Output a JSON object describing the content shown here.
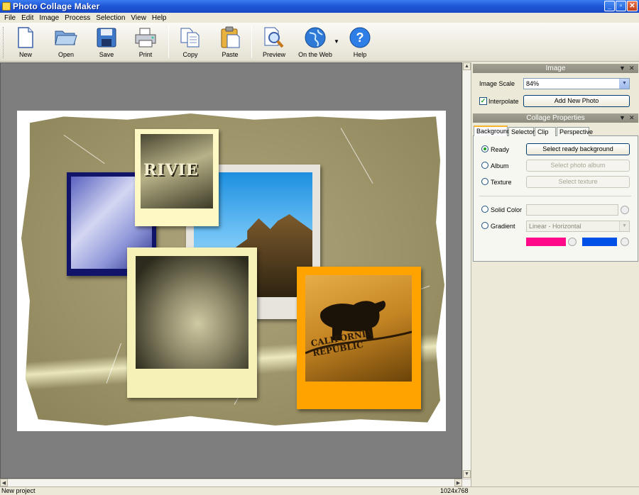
{
  "window": {
    "title": "Photo Collage Maker"
  },
  "menu": [
    "File",
    "Edit",
    "Image",
    "Process",
    "Selection",
    "View",
    "Help"
  ],
  "toolbar": {
    "buttons": [
      {
        "label": "New",
        "icon": "new-document-icon"
      },
      {
        "label": "Open",
        "icon": "open-folder-icon"
      },
      {
        "label": "Save",
        "icon": "floppy-disk-icon"
      },
      {
        "label": "Print",
        "icon": "printer-icon"
      },
      {
        "label": "Copy",
        "icon": "copy-icon"
      },
      {
        "label": "Paste",
        "icon": "clipboard-icon"
      },
      {
        "label": "Preview",
        "icon": "magnifier-icon"
      },
      {
        "label": "On the Web",
        "icon": "globe-icon"
      },
      {
        "label": "Help",
        "icon": "help-icon"
      }
    ]
  },
  "canvas": {
    "photos": [
      {
        "name": "blue-flag-photo"
      },
      {
        "name": "building-photo"
      },
      {
        "name": "rivie-sign-photo",
        "text": "RIVIE"
      },
      {
        "name": "bunny-photo"
      },
      {
        "name": "california-flag-photo",
        "text": "CALIFORNIA REPUBLIC"
      }
    ]
  },
  "image_panel": {
    "title": "Image",
    "scale_label": "Image Scale",
    "scale_value": "84%",
    "interpolate_label": "Interpolate",
    "interpolate_checked": true,
    "add_photo_label": "Add New Photo"
  },
  "collage_panel": {
    "title": "Collage Properties",
    "tabs": [
      "Background",
      "Selector",
      "Clip Art",
      "Perspective"
    ],
    "active_tab": "Background",
    "options": {
      "ready": {
        "label": "Ready",
        "button": "Select ready background",
        "checked": true
      },
      "album": {
        "label": "Album",
        "button": "Select photo album"
      },
      "texture": {
        "label": "Texture",
        "button": "Select texture"
      },
      "solid": {
        "label": "Solid Color"
      },
      "gradient": {
        "label": "Gradient",
        "value": "Linear - Horizontal"
      }
    },
    "colors": {
      "gradient_start": "#ff0a88",
      "gradient_end": "#0050e8"
    }
  },
  "status": {
    "left": "New project",
    "right": "1024x768"
  }
}
